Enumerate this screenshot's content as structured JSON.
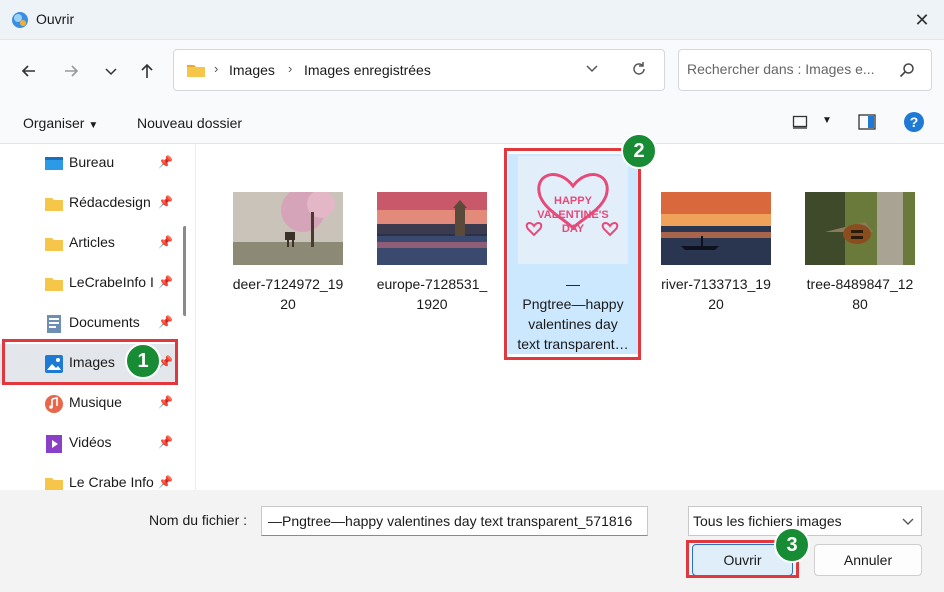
{
  "window": {
    "title": "Ouvrir",
    "close_glyph": "✕"
  },
  "nav": {
    "breadcrumb": [
      "Images",
      "Images enregistrées"
    ],
    "search_placeholder": "Rechercher dans : Images e..."
  },
  "toolbar": {
    "organiser_label": "Organiser",
    "new_folder_label": "Nouveau dossier",
    "help_glyph": "?"
  },
  "sidebar": {
    "items": [
      {
        "label": "Bureau",
        "icon": "desktop-icon"
      },
      {
        "label": "Rédacdesign",
        "icon": "folder-icon"
      },
      {
        "label": "Articles",
        "icon": "folder-icon"
      },
      {
        "label": "LeCrabeInfo I",
        "icon": "folder-icon"
      },
      {
        "label": "Documents",
        "icon": "documents-icon"
      },
      {
        "label": "Images",
        "icon": "images-icon",
        "selected": true
      },
      {
        "label": "Musique",
        "icon": "music-icon"
      },
      {
        "label": "Vidéos",
        "icon": "videos-icon"
      },
      {
        "label": "Le Crabe Info",
        "icon": "folder-icon"
      }
    ]
  },
  "files": [
    {
      "name_line1": "deer-7124972_19",
      "name_line2": "20"
    },
    {
      "name_line1": "europe-7128531_",
      "name_line2": "1920"
    },
    {
      "name_line1": "—",
      "name_line2": "Pngtree—happy",
      "name_line3": "valentines day",
      "name_line4": "text transparent…",
      "thumb_text_1": "HAPPY",
      "thumb_text_2": "VALENTINE'S",
      "thumb_text_3": "DAY",
      "selected": true
    },
    {
      "name_line1": "river-7133713_19",
      "name_line2": "20"
    },
    {
      "name_line1": "tree-8489847_12",
      "name_line2": "80"
    }
  ],
  "footer": {
    "filename_label": "Nom du fichier :",
    "filename_value": "—Pngtree—happy valentines day text transparent_571816",
    "filetype_value": "Tous les fichiers images",
    "open_label": "Ouvrir",
    "cancel_label": "Annuler"
  },
  "annotations": {
    "badge_1": "1",
    "badge_2": "2",
    "badge_3": "3",
    "highlight_color": "#e0383d",
    "badge_color": "#178c35"
  }
}
